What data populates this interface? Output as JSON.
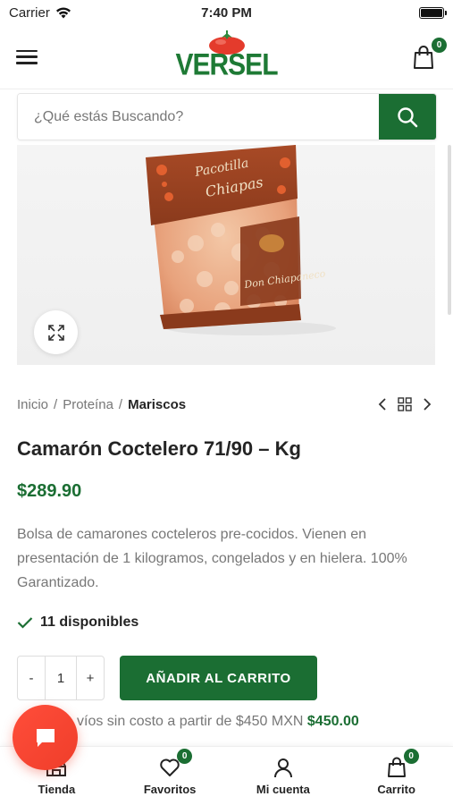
{
  "status_bar": {
    "carrier": "Carrier",
    "time": "7:40 PM"
  },
  "header": {
    "logo_text": "VERSEL",
    "cart_count": "0"
  },
  "search": {
    "placeholder": "¿Qué estás Buscando?"
  },
  "breadcrumb": {
    "items": [
      "Inicio",
      "Proteína"
    ],
    "current": "Mariscos"
  },
  "product": {
    "title": "Camarón Coctelero 71/90 – Kg",
    "price": "$289.90",
    "description": "Bolsa de camarones cocteleros pre-cocidos. Vienen en presentación de 1 kilogramos, congelados y en hielera. 100% Garantizado.",
    "stock": "11 disponibles",
    "quantity": "1",
    "qty_minus": "-",
    "qty_plus": "+",
    "add_to_cart": "AÑADIR AL CARRITO",
    "package_text": "Pacotilla Chiapas"
  },
  "shipping": {
    "text": "víos sin costo a partir de $450 MXN",
    "amount": "$450.00"
  },
  "tabbar": {
    "tabs": [
      {
        "label": "Tienda"
      },
      {
        "label": "Favoritos",
        "count": "0"
      },
      {
        "label": "Mi cuenta"
      },
      {
        "label": "Carrito",
        "count": "0"
      }
    ]
  },
  "colors": {
    "brand_green": "#1b6e33",
    "chat_red": "#ef3e2a",
    "muted_text": "#777777"
  },
  "icons": [
    "wifi-icon",
    "battery-icon",
    "menu-icon",
    "shopping-bag-icon",
    "search-icon",
    "expand-icon",
    "chevron-left-icon",
    "grid-icon",
    "chevron-right-icon",
    "check-icon",
    "store-icon",
    "heart-icon",
    "user-icon",
    "chat-icon"
  ]
}
